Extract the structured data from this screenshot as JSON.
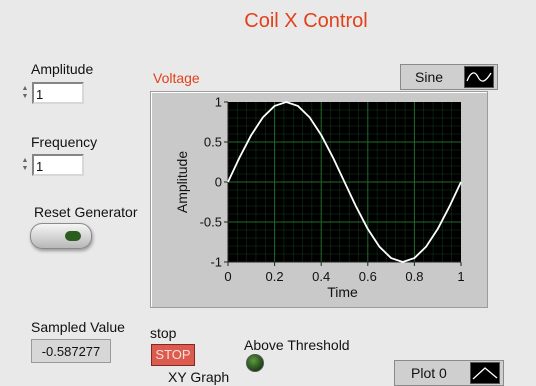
{
  "window": {
    "title": "Coil X Control"
  },
  "controls": {
    "amplitude": {
      "label": "Amplitude",
      "value": "1"
    },
    "frequency": {
      "label": "Frequency",
      "value": "1"
    },
    "reset": {
      "label": "Reset Generator"
    },
    "sampled": {
      "label": "Sampled Value",
      "value": "-0.587277"
    },
    "stop": {
      "label": "stop",
      "button": "STOP"
    },
    "threshold": {
      "label": "Above Threshold"
    },
    "xy_graph": {
      "label": "XY Graph"
    }
  },
  "graph": {
    "label": "Voltage",
    "legend": "Sine",
    "legend_icon": "sine-wave-icon",
    "bottom_legend": "Plot 0",
    "bottom_legend_icon": "plot-line-icon",
    "colors": {
      "plot_bg": "#000000",
      "grid": "#1f6b2c",
      "trace": "#ffffff",
      "accent": "#e2411b"
    }
  },
  "chart_data": {
    "type": "line",
    "xlabel": "Time",
    "ylabel": "Amplitude",
    "xlim": [
      0,
      1
    ],
    "ylim": [
      -1,
      1
    ],
    "x_ticks": [
      "0",
      "0.2",
      "0.4",
      "0.6",
      "0.8",
      "1"
    ],
    "y_ticks": [
      "1",
      "0.5",
      "0",
      "-0.5",
      "-1"
    ],
    "grid": true,
    "series": [
      {
        "x": [
          0,
          0.05,
          0.1,
          0.15,
          0.2,
          0.25,
          0.3,
          0.35,
          0.4,
          0.45,
          0.5,
          0.55,
          0.6,
          0.65,
          0.7,
          0.75,
          0.8,
          0.85,
          0.9,
          0.95,
          1
        ],
        "values": [
          0,
          0.309,
          0.588,
          0.809,
          0.951,
          1,
          0.951,
          0.809,
          0.588,
          0.309,
          0,
          -0.309,
          -0.588,
          -0.809,
          -0.951,
          -1,
          -0.951,
          -0.809,
          -0.588,
          -0.309,
          0
        ]
      }
    ]
  }
}
